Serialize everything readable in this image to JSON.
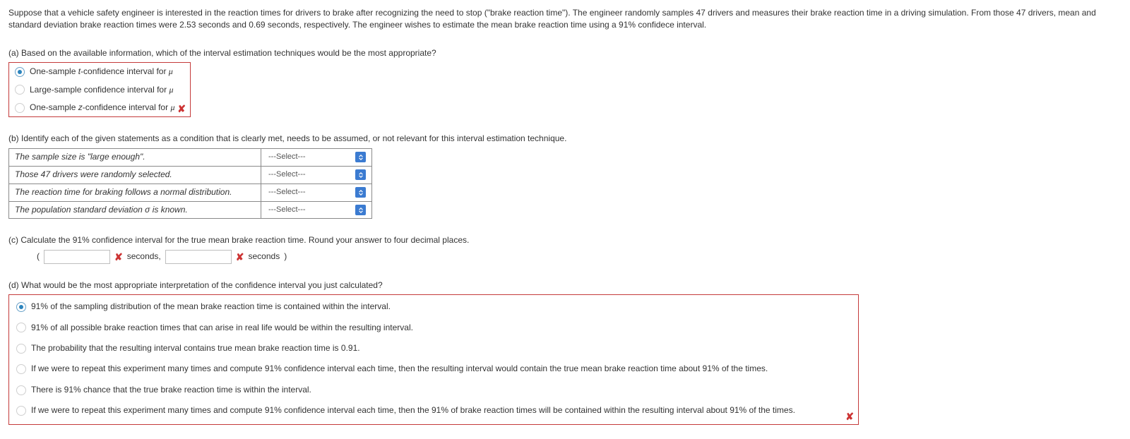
{
  "intro": "Suppose that a vehicle safety engineer is interested in the reaction times for drivers to brake after recognizing the need to stop (\"brake reaction time\"). The engineer randomly samples 47 drivers and measures their brake reaction time in a driving simulation. From those 47 drivers, mean and standard deviation brake reaction times were 2.53 seconds and 0.69 seconds, respectively. The engineer wishes to estimate the mean brake reaction time using a 91% confidece interval.",
  "a": {
    "prompt": "(a) Based on the available information, which of the interval estimation techniques would be the most appropriate?",
    "options": [
      {
        "pre": "One-sample ",
        "ital": "t",
        "post": "-confidence interval for ",
        "selected": true
      },
      {
        "pre": "Large-sample confidence interval for ",
        "ital": "",
        "post": "",
        "selected": false
      },
      {
        "pre": "One-sample ",
        "ital": "z",
        "post": "-confidence interval for ",
        "selected": false
      }
    ],
    "wrong_mark": "✘"
  },
  "b": {
    "prompt": "(b) Identify each of the given statements as a condition that is clearly met, needs to be assumed, or not relevant for this interval estimation technique.",
    "select_placeholder": "---Select---",
    "rows": [
      "The sample size is \"large enough\".",
      "Those 47 drivers were randomly selected.",
      "The reaction time for braking follows a normal distribution.",
      "The population standard deviation σ is known."
    ]
  },
  "c": {
    "prompt": "(c) Calculate the 91% confidence interval for the true mean brake reaction time. Round your answer to four decimal places.",
    "paren_open": "(",
    "paren_close": ")",
    "unit_comma": "seconds,",
    "unit_end": "seconds",
    "wrong_mark": "✘"
  },
  "d": {
    "prompt": "(d) What would be the most appropriate interpretation of the confidence interval you just calculated?",
    "options": [
      {
        "text": "91% of the sampling distribution of the mean brake reaction time is contained within the interval.",
        "selected": true
      },
      {
        "text": "91% of all possible brake reaction times that can arise in real life would be within the resulting interval.",
        "selected": false
      },
      {
        "text": "The probability that the resulting interval contains true mean brake reaction time is 0.91.",
        "selected": false
      },
      {
        "text": "If we were to repeat this experiment many times and compute 91% confidence interval each time, then the resulting interval would contain the true mean brake reaction time about 91% of the times.",
        "selected": false
      },
      {
        "text": "There is 91% chance that the true brake reaction time is within the interval.",
        "selected": false
      },
      {
        "text": "If we were to repeat this experiment many times and compute 91% confidence interval each time, then the 91% of brake reaction times will be contained within the resulting interval about 91% of the times.",
        "selected": false
      }
    ],
    "wrong_mark": "✘"
  }
}
